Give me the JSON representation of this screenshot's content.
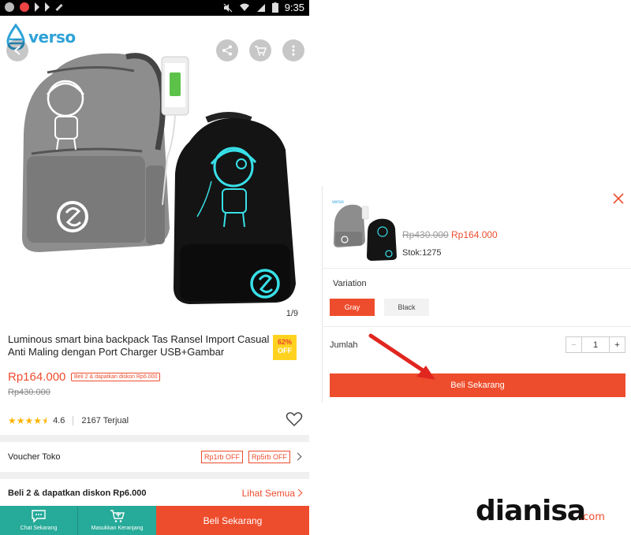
{
  "status_bar": {
    "time": "9:35"
  },
  "brand": {
    "logo_text": "verso"
  },
  "product": {
    "image_counter": "1/9",
    "title": "Luminous smart bina backpack Tas Ransel Import Casual Anti Maling dengan Port Charger USB+Gambar",
    "discount_percent": "62%",
    "discount_off": "OFF",
    "price": "Rp164.000",
    "promo_tag": "Beli 2 & dapatkan diskon Rp6.000",
    "old_price": "Rp430.000",
    "rating_value": 4.6,
    "rating_display": "4.6",
    "sold": "2167 Terjual"
  },
  "voucher": {
    "label": "Voucher Toko",
    "tags": [
      "Rp1rb OFF",
      "Rp5rb OFF"
    ]
  },
  "bundle": {
    "label": "Beli 2 & dapatkan diskon Rp6.000",
    "see_all": "Lihat Semua"
  },
  "bottom_bar": {
    "chat_label": "Chat Sekarang",
    "cart_label": "Masukkan Keranjang",
    "buy_label": "Beli Sekarang"
  },
  "modal": {
    "old_price": "Rp430.000",
    "price": "Rp164.000",
    "stock": "Stok:1275",
    "variation_label": "Variation",
    "options": [
      "Gray",
      "Black"
    ],
    "selected_option": "Gray",
    "quantity_label": "Jumlah",
    "quantity_value": "1",
    "minus": "−",
    "plus": "+",
    "buy_label": "Beli Sekarang"
  },
  "watermark": {
    "text": "dianisa",
    "suffix": ".com"
  },
  "colors": {
    "accent": "#ee4d2d",
    "teal": "#26aa99",
    "badge": "#ffd21f",
    "glow": "#38e0e8"
  },
  "icons": [
    "back-icon",
    "share-icon",
    "cart-icon",
    "more-icon",
    "heart-icon",
    "chat-icon",
    "add-to-cart-icon",
    "close-icon",
    "star-icon",
    "chevron-right-icon"
  ]
}
